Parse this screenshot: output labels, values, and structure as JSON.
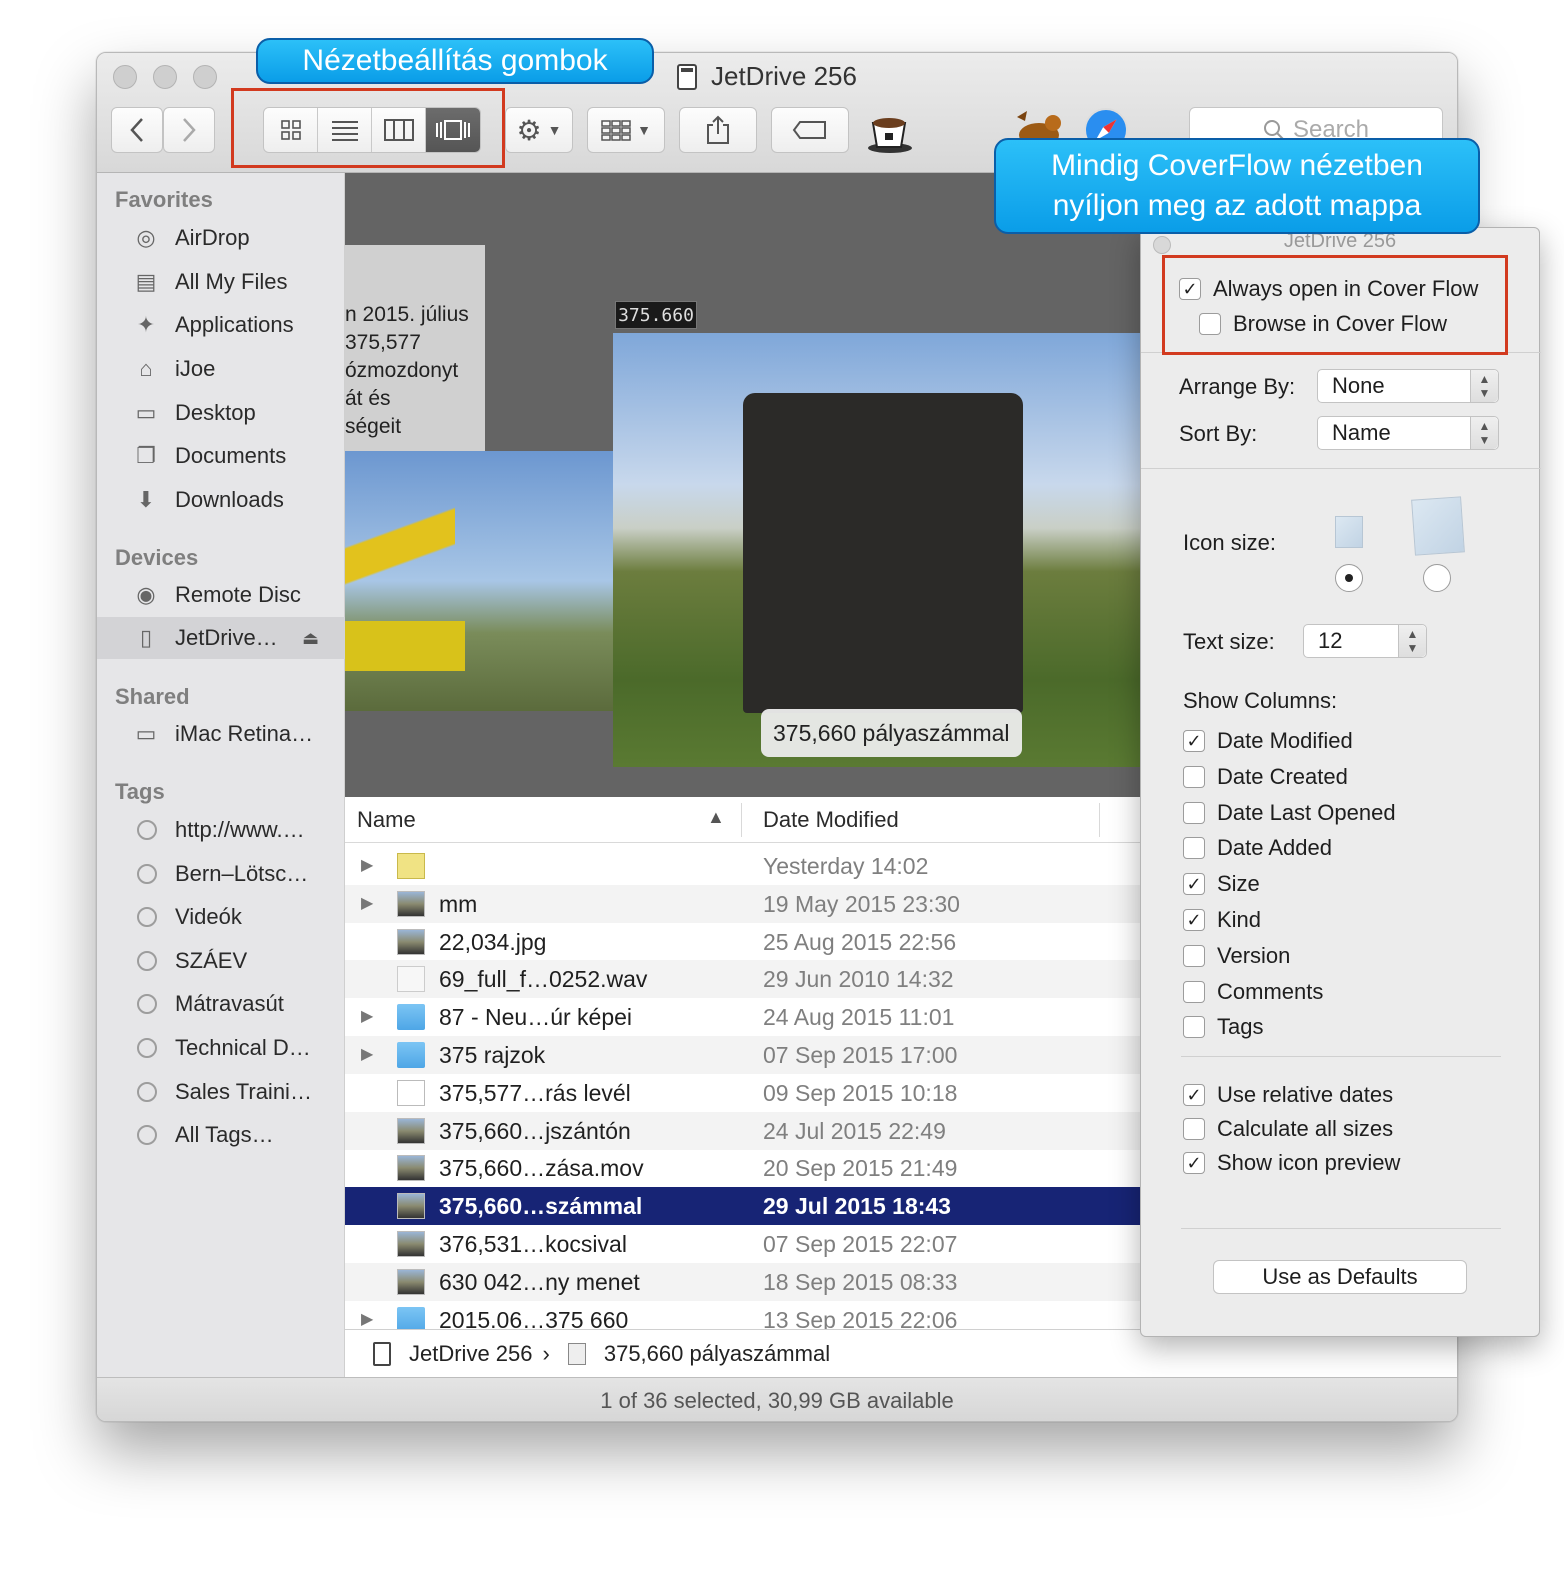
{
  "window": {
    "title": "JetDrive 256"
  },
  "toolbar": {
    "back_label": "<",
    "forward_label": ">",
    "search_placeholder": "Search"
  },
  "callouts": {
    "view_buttons": "Nézetbeállítás gombok",
    "coverflow": "Mindig CoverFlow nézetben nyíljon meg az adott mappa"
  },
  "sidebar": {
    "favorites_label": "Favorites",
    "favorites": [
      "AirDrop",
      "All My Files",
      "Applications",
      "iJoe",
      "Desktop",
      "Documents",
      "Downloads"
    ],
    "devices_label": "Devices",
    "devices": [
      "Remote Disc",
      "JetDrive…"
    ],
    "shared_label": "Shared",
    "shared": [
      "iMac Retina…"
    ],
    "tags_label": "Tags",
    "tags": [
      "http://www.…",
      "Bern–Lötsc…",
      "Videók",
      "SZÁEV",
      "Mátravasút",
      "Technical D…",
      "Sales Traini…",
      "All Tags…"
    ]
  },
  "coverflow": {
    "doc_lines": [
      "n 2015. július",
      " 375,577",
      "ózmozdonyt",
      "át és",
      " ségeit"
    ],
    "plate": "375.660",
    "caption": "375,660 pályaszámmal"
  },
  "list": {
    "col_name": "Name",
    "col_date": "Date Modified",
    "rows": [
      {
        "name": "",
        "date": "Yesterday 14:02",
        "type": "note",
        "disclosure": true
      },
      {
        "name": "mm",
        "date": "19 May 2015 23:30",
        "type": "img",
        "disclosure": true
      },
      {
        "name": "22,034.jpg",
        "date": "25 Aug 2015 22:56",
        "type": "img",
        "disclosure": false
      },
      {
        "name": "69_full_f…0252.wav",
        "date": "29 Jun 2010 14:32",
        "type": "wav",
        "disclosure": false
      },
      {
        "name": "87 - Neu…úr képei",
        "date": "24 Aug 2015 11:01",
        "type": "folder",
        "disclosure": true
      },
      {
        "name": "375 rajzok",
        "date": "07 Sep 2015 17:00",
        "type": "folder",
        "disclosure": true
      },
      {
        "name": "375,577…rás levél",
        "date": "09 Sep 2015 10:18",
        "type": "doc",
        "disclosure": false
      },
      {
        "name": "375,660…jszántón",
        "date": "24 Jul 2015 22:49",
        "type": "img",
        "disclosure": false
      },
      {
        "name": "375,660…zása.mov",
        "date": "20 Sep 2015 21:49",
        "type": "img",
        "disclosure": false
      },
      {
        "name": "375,660…számmal",
        "date": "29 Jul 2015 18:43",
        "type": "img",
        "disclosure": false,
        "selected": true
      },
      {
        "name": "376,531…kocsival",
        "date": "07 Sep 2015 22:07",
        "type": "img",
        "disclosure": false
      },
      {
        "name": "630 042…ny menet",
        "date": "18 Sep 2015 08:33",
        "type": "img",
        "disclosure": false
      },
      {
        "name": "2015.06…375 660",
        "date": "13 Sep 2015 22:06",
        "type": "folder",
        "disclosure": true
      }
    ]
  },
  "pathbar": {
    "root": "JetDrive 256",
    "separator": "›",
    "file": "375,660 pályaszámmal"
  },
  "status": {
    "text": "1 of 36 selected, 30,99 GB available"
  },
  "panel": {
    "title": "JetDrive 256",
    "always_open": {
      "label": "Always open in Cover Flow",
      "checked": true
    },
    "browse": {
      "label": "Browse in Cover Flow",
      "checked": false
    },
    "arrange_label": "Arrange By:",
    "arrange_value": "None",
    "sort_label": "Sort By:",
    "sort_value": "Name",
    "icon_size_label": "Icon size:",
    "text_size_label": "Text size:",
    "text_size_value": "12",
    "show_columns_label": "Show Columns:",
    "columns": [
      {
        "label": "Date Modified",
        "checked": true
      },
      {
        "label": "Date Created",
        "checked": false
      },
      {
        "label": "Date Last Opened",
        "checked": false
      },
      {
        "label": "Date Added",
        "checked": false
      },
      {
        "label": "Size",
        "checked": true
      },
      {
        "label": "Kind",
        "checked": true
      },
      {
        "label": "Version",
        "checked": false
      },
      {
        "label": "Comments",
        "checked": false
      },
      {
        "label": "Tags",
        "checked": false
      }
    ],
    "options": [
      {
        "label": "Use relative dates",
        "checked": true
      },
      {
        "label": "Calculate all sizes",
        "checked": false
      },
      {
        "label": "Show icon preview",
        "checked": true
      }
    ],
    "defaults_button": "Use as Defaults"
  },
  "colors": {
    "selection": "#172475",
    "callout": "#0a9de8",
    "highlight_box": "#d23a1f"
  }
}
